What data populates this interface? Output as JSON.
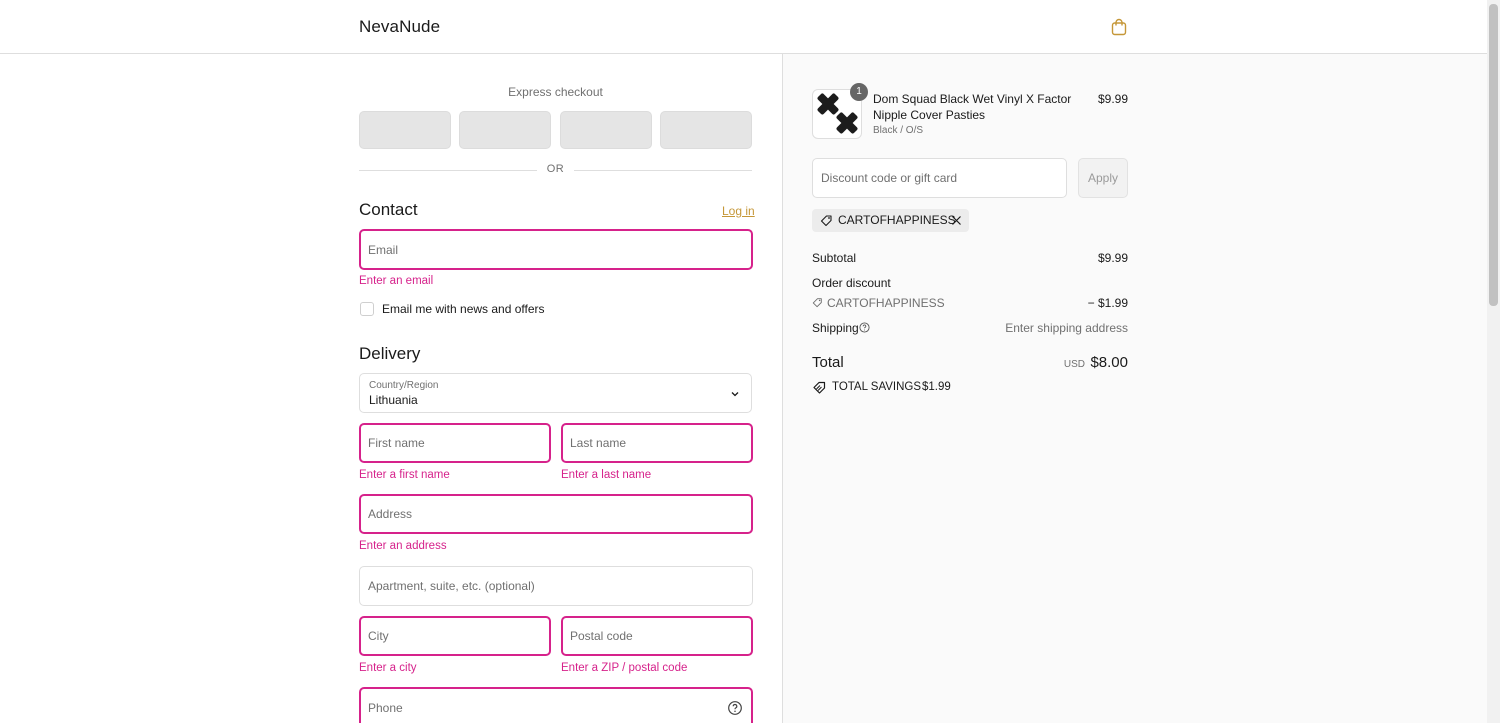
{
  "header": {
    "brand": "NevaNude",
    "cart_icon": "shopping-bag-icon",
    "accent": "#c59738"
  },
  "express_checkout": {
    "title": "Express checkout",
    "divider": "OR"
  },
  "contact": {
    "title": "Contact",
    "login_link": "Log in",
    "email_placeholder": "Email",
    "email_error": "Enter an email",
    "newsletter_label": "Email me with news and offers"
  },
  "delivery": {
    "title": "Delivery",
    "country_label": "Country/Region",
    "country_value": "Lithuania",
    "first_name_placeholder": "First name",
    "first_name_error": "Enter a first name",
    "last_name_placeholder": "Last name",
    "last_name_error": "Enter a last name",
    "address_placeholder": "Address",
    "address_error": "Enter an address",
    "apartment_placeholder": "Apartment, suite, etc. (optional)",
    "city_placeholder": "City",
    "city_error": "Enter a city",
    "postal_placeholder": "Postal code",
    "postal_error": "Enter a ZIP / postal code",
    "phone_placeholder": "Phone"
  },
  "order": {
    "item": {
      "quantity": "1",
      "name": "Dom Squad Black Wet Vinyl X Factor Nipple Cover Pasties",
      "variant": "Black / O/S",
      "price": "$9.99"
    },
    "discount_placeholder": "Discount code or gift card",
    "apply_label": "Apply",
    "applied_code": "CARTOFHAPPINESS",
    "subtotal_label": "Subtotal",
    "subtotal_value": "$9.99",
    "order_discount_label": "Order discount",
    "discount_code": "CARTOFHAPPINESS",
    "discount_value": "− $1.99",
    "shipping_label": "Shipping",
    "shipping_value": "Enter shipping address",
    "total_label": "Total",
    "currency": "USD",
    "total_value": "$8.00",
    "savings_label": "TOTAL SAVINGS",
    "savings_value": "$1.99"
  },
  "colors": {
    "error": "#d6228b",
    "link": "#c59738",
    "muted": "#707070"
  }
}
